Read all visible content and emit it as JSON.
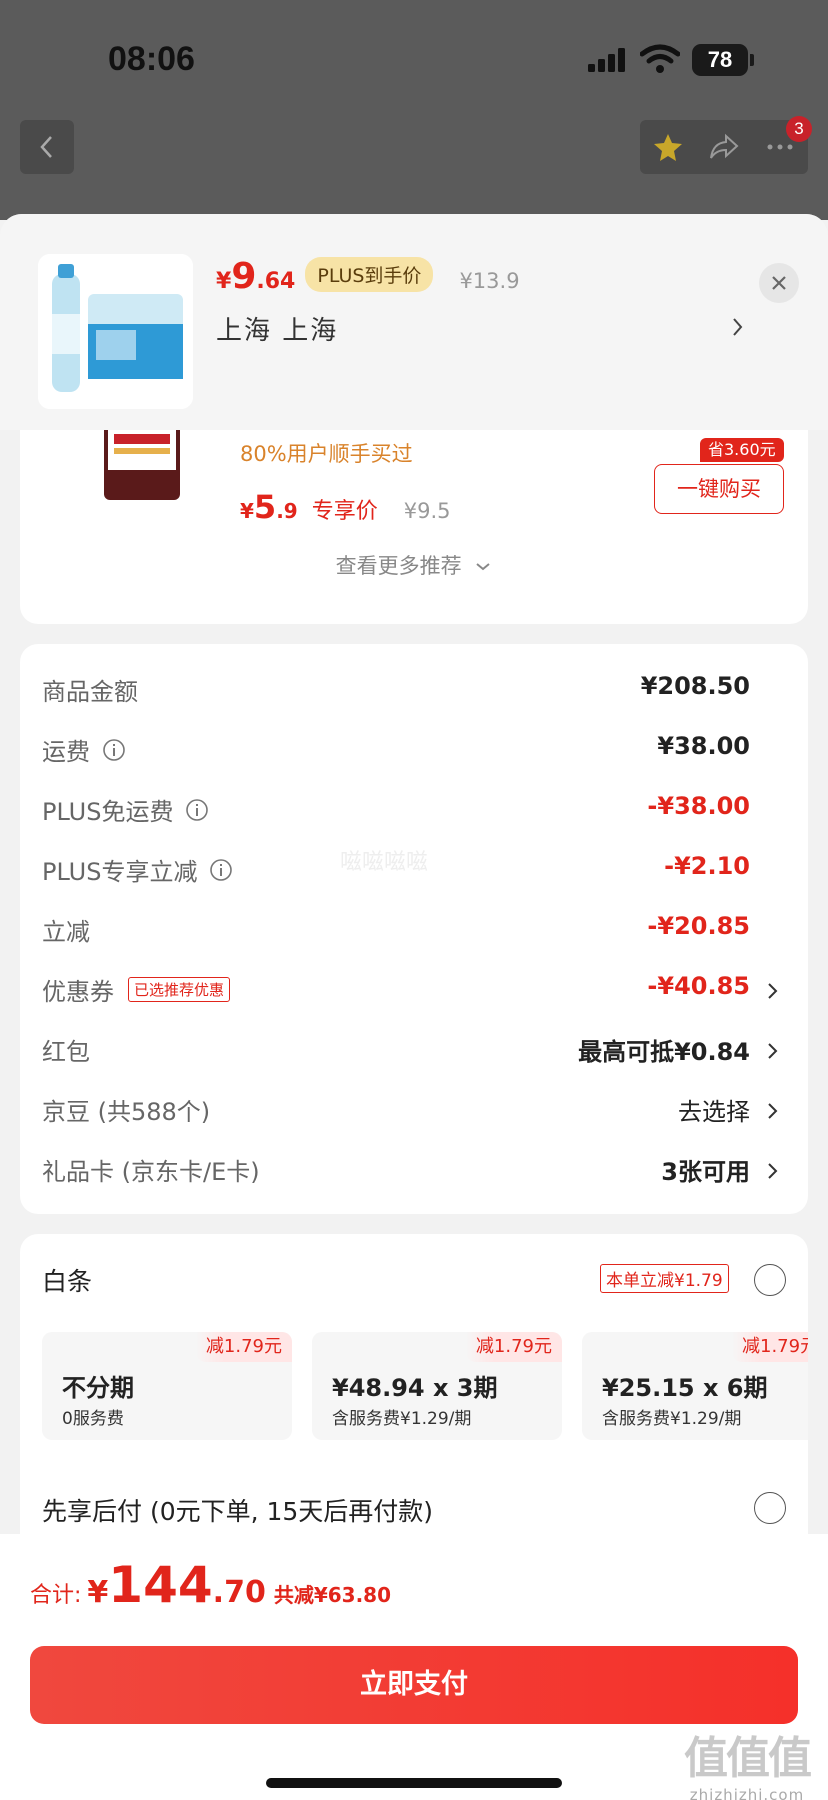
{
  "status_bar": {
    "time": "08:06",
    "battery": "78"
  },
  "nav": {
    "badge_count": "3"
  },
  "product": {
    "price_yen": "¥",
    "price_int": "9",
    "price_dec": ".64",
    "plus_tag": "PLUS到手价",
    "original_price": "¥13.9",
    "location": "上海  上海"
  },
  "recommendation": {
    "buyers_text": "80%用户顺手买过",
    "price_yen": "¥",
    "price_int": "5",
    "price_dec": ".9",
    "price_tag": "专享价",
    "original_price": "¥9.5",
    "save_badge": "省3.60元",
    "buy_button": "一键购买",
    "more_link": "查看更多推荐"
  },
  "costs": [
    {
      "label": "商品金额",
      "value": "¥208.50",
      "style": "normal",
      "info": false,
      "chevron": false
    },
    {
      "label": "运费",
      "value": "¥38.00",
      "style": "normal",
      "info": true,
      "chevron": false
    },
    {
      "label": "PLUS免运费",
      "value": "-¥38.00",
      "style": "red",
      "info": true,
      "chevron": false
    },
    {
      "label": "PLUS专享立减",
      "value": "-¥2.10",
      "style": "red",
      "info": true,
      "chevron": false
    },
    {
      "label": "立减",
      "value": "-¥20.85",
      "style": "red",
      "info": false,
      "chevron": false
    },
    {
      "label": "优惠券",
      "value": "-¥40.85",
      "style": "red",
      "info": false,
      "chevron": true,
      "tag": "已选推荐优惠"
    },
    {
      "label": "红包",
      "value": "最高可抵¥0.84",
      "style": "bold",
      "info": false,
      "chevron": true
    },
    {
      "label": "京豆 (共588个)",
      "value": "去选择",
      "style": "plain",
      "info": false,
      "chevron": true
    },
    {
      "label": "礼品卡 (京东卡/E卡)",
      "value": "3张可用",
      "style": "bold",
      "info": false,
      "chevron": true
    }
  ],
  "watermark_mid": "嗞嗞嗞嗞",
  "payment": {
    "baitiao_label": "白条",
    "baitiao_tag": "本单立减¥1.79",
    "installments": [
      {
        "discount": "减1.79元",
        "title": "不分期",
        "sub": "0服务费"
      },
      {
        "discount": "减1.79元",
        "title": "¥48.94 x 3期",
        "sub": "含服务费¥1.29/期"
      },
      {
        "discount": "减1.79元",
        "title": "¥25.15 x 6期",
        "sub": "含服务费¥1.29/期"
      }
    ],
    "bnpl_label": "先享后付 (0元下单, 15天后再付款)"
  },
  "footer": {
    "total_label": "合计:",
    "total_yen": "¥",
    "total_int": "144",
    "total_dec": ".70",
    "total_saved": "共减¥63.80",
    "pay_button": "立即支付"
  },
  "site_mark": {
    "logo": "值值值",
    "url": "zhizhizhi.com"
  },
  "colors": {
    "accent": "#e1251b",
    "plus_gold": "#f7e3a6"
  }
}
